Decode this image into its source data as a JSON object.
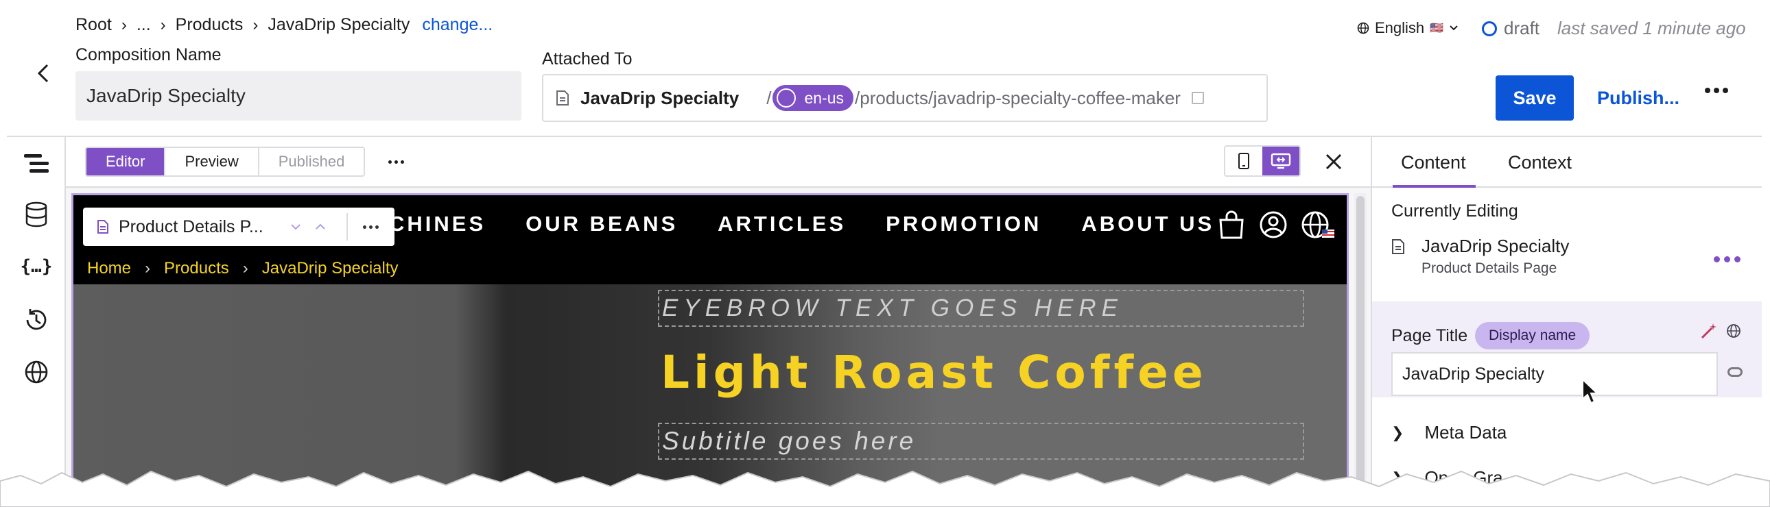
{
  "header": {
    "breadcrumb": {
      "root": "Root",
      "ellipsis": "...",
      "products": "Products",
      "current": "JavaDrip Specialty",
      "change_link": "change..."
    },
    "composition_name": {
      "label": "Composition Name",
      "value": "JavaDrip Specialty"
    },
    "attached_to": {
      "label": "Attached To",
      "entry_name": "JavaDrip Specialty",
      "slash": "/",
      "locale": "en-us",
      "path": "/products/javadrip-specialty-coffee-maker"
    },
    "language": {
      "label": "English",
      "flag": "🇺🇸"
    },
    "status": {
      "state": "draft",
      "last_saved": "last saved 1 minute ago"
    },
    "save_label": "Save",
    "publish_label": "Publish...",
    "accent_color": "#0b55d6"
  },
  "toolbar": {
    "modes": [
      "Editor",
      "Preview",
      "Published"
    ],
    "active_mode": "Editor",
    "device": "desktop",
    "accent_color": "#7f4fc6"
  },
  "preview": {
    "component_selector": {
      "name": "Product Details P..."
    },
    "nav_links": [
      "CHINES",
      "OUR BEANS",
      "ARTICLES",
      "PROMOTION",
      "ABOUT US"
    ],
    "breadcrumb": [
      "Home",
      "Products",
      "JavaDrip Specialty"
    ],
    "eyebrow": "EYEBROW TEXT GOES HERE",
    "title": "Light Roast Coffee",
    "subtitle": "Subtitle goes here",
    "title_color": "#f5d224"
  },
  "panel": {
    "tabs": [
      "Content",
      "Context"
    ],
    "active_tab": "Content",
    "currently_editing": {
      "heading": "Currently Editing",
      "name": "JavaDrip Specialty",
      "type": "Product Details Page"
    },
    "page_title": {
      "label": "Page Title",
      "badge": "Display name",
      "value": "JavaDrip Specialty"
    },
    "accordions": [
      "Meta Data",
      "Open Gra"
    ]
  }
}
